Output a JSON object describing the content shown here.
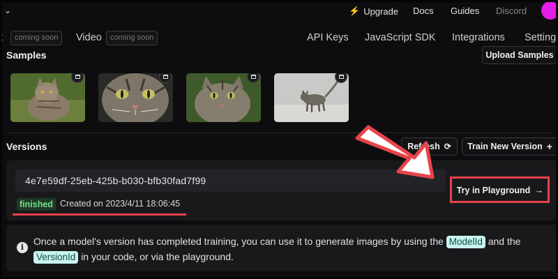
{
  "topbar": {
    "upgrade_label": "Upgrade",
    "docs_label": "Docs",
    "guides_label": "Guides",
    "discord_label": "Discord",
    "avatar_color": "#e21ee8"
  },
  "nav": {
    "partial_item": "t",
    "coming_soon": "coming soon",
    "video_label": "Video",
    "api_keys_label": "API Keys",
    "js_sdk_label": "JavaScript SDK",
    "integrations_label": "Integrations",
    "settings_label": "Setting"
  },
  "samples": {
    "title": "Samples",
    "upload_label": "Upload Samples",
    "thumbnails": [
      "cat-sample-1",
      "cat-sample-2",
      "cat-sample-3",
      "cat-sample-4"
    ]
  },
  "versions": {
    "title": "Versions",
    "refresh_label": "Refresh",
    "train_label": "Train New Version",
    "version_id": "4e7e59df-25eb-425b-b030-bfb30fad7f99",
    "status": "finished",
    "created": "Created on 2023/4/11 18:06:45",
    "try_label": "Try in Playground"
  },
  "info": {
    "text_1": "Once a model's version has completed training, you can use it to generate images by using the",
    "chip_1": "ModelId",
    "text_2": "and the",
    "chip_2": "VersionId",
    "text_3": "in your code, or via the playground."
  },
  "colors": {
    "background": "#0d0d0f",
    "card": "#19191c",
    "highlight_red": "#e8434b",
    "status_green": "#6fe08c",
    "chip_bg": "#c9f3ee"
  }
}
